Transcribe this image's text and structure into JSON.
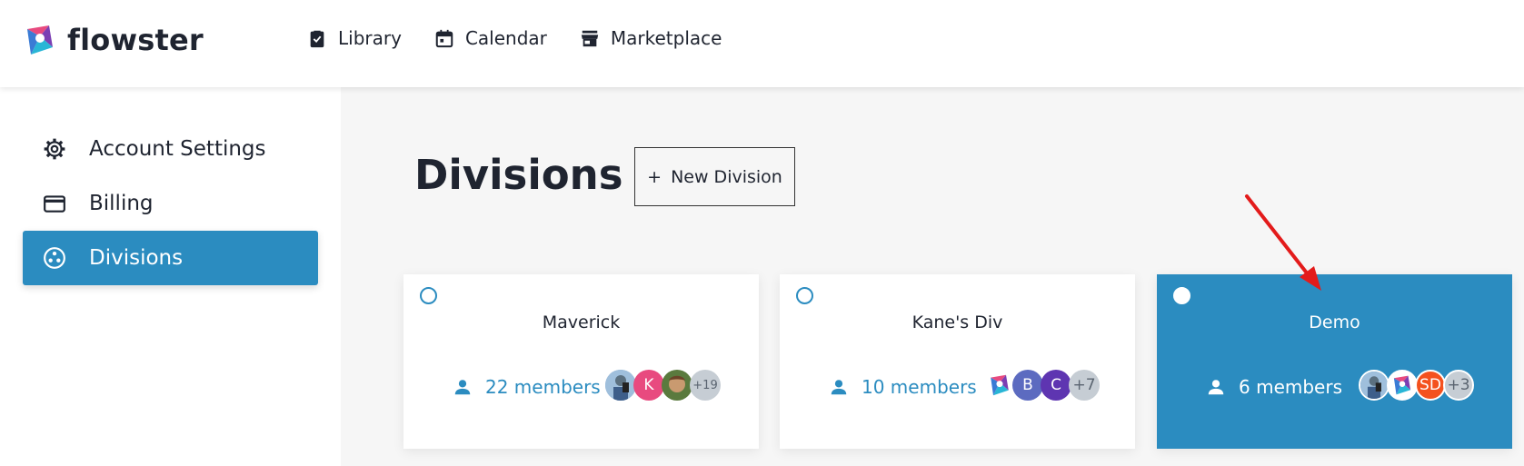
{
  "brand": {
    "name": "flowster"
  },
  "nav": [
    {
      "label": "Library",
      "icon": "clipboard-check-icon"
    },
    {
      "label": "Calendar",
      "icon": "calendar-icon"
    },
    {
      "label": "Marketplace",
      "icon": "store-icon"
    }
  ],
  "sidebar": {
    "items": [
      {
        "label": "Account Settings",
        "icon": "gear-icon",
        "active": false
      },
      {
        "label": "Billing",
        "icon": "credit-card-icon",
        "active": false
      },
      {
        "label": "Divisions",
        "icon": "divisions-icon",
        "active": true
      }
    ]
  },
  "main": {
    "title": "Divisions",
    "new_button": {
      "icon": "+",
      "label": "New Division"
    },
    "cards": [
      {
        "name": "Maverick",
        "members": "22 members",
        "selected": false,
        "avatars": [
          {
            "kind": "photo",
            "color": "#7aa0c8"
          },
          {
            "kind": "letter",
            "text": "K",
            "color": "#e84a7f"
          },
          {
            "kind": "photo",
            "color": "#a06a3e"
          },
          {
            "kind": "more",
            "text": "+19"
          }
        ]
      },
      {
        "name": "Kane's Div",
        "members": "10 members",
        "selected": false,
        "avatars": [
          {
            "kind": "logo"
          },
          {
            "kind": "letter",
            "text": "B",
            "color": "#5c6bc0"
          },
          {
            "kind": "letter",
            "text": "C",
            "color": "#5e35b1"
          },
          {
            "kind": "more",
            "text": "+7"
          }
        ]
      },
      {
        "name": "Demo",
        "members": "6 members",
        "selected": true,
        "avatars": [
          {
            "kind": "photo",
            "color": "#7aa0c8"
          },
          {
            "kind": "logo"
          },
          {
            "kind": "letter",
            "text": "SD",
            "color": "#f4511e"
          },
          {
            "kind": "more",
            "text": "+3"
          }
        ]
      }
    ]
  },
  "colors": {
    "accent": "#2b8cc0",
    "annotation_arrow": "#e31b1b"
  }
}
